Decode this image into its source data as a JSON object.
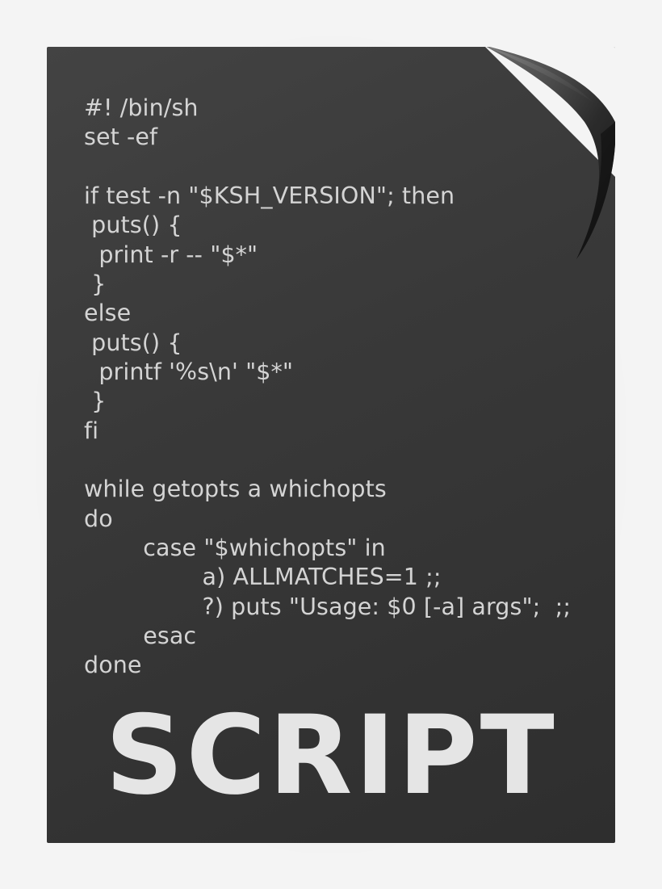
{
  "file_icon": {
    "title": "SCRIPT",
    "code_lines": [
      "#! /bin/sh",
      "set -ef",
      "",
      "if test -n \"$KSH_VERSION\"; then",
      " puts() {",
      "  print -r -- \"$*\"",
      " }",
      "else",
      " puts() {",
      "  printf '%s\\n' \"$*\"",
      " }",
      "fi",
      "",
      "while getopts a whichopts",
      "do",
      "        case \"$whichopts\" in",
      "                a) ALLMATCHES=1 ;;",
      "                ?) puts \"Usage: $0 [-a] args\";  ;;",
      "        esac",
      "done"
    ]
  }
}
